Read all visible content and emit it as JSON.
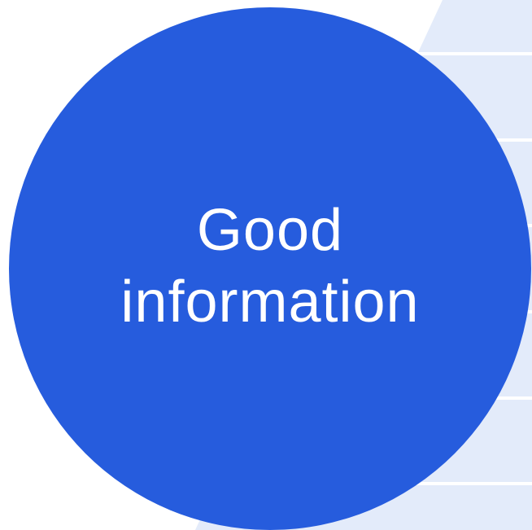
{
  "diagram": {
    "circle": {
      "label_line1": "Good",
      "label_line2": "information",
      "fill": "#265CDD",
      "text_color": "#FFFFFF"
    },
    "background_wedge": {
      "fill": "#E3EBFA",
      "divider_color": "#FFFFFF"
    },
    "page_background": "#FFFFFF"
  }
}
